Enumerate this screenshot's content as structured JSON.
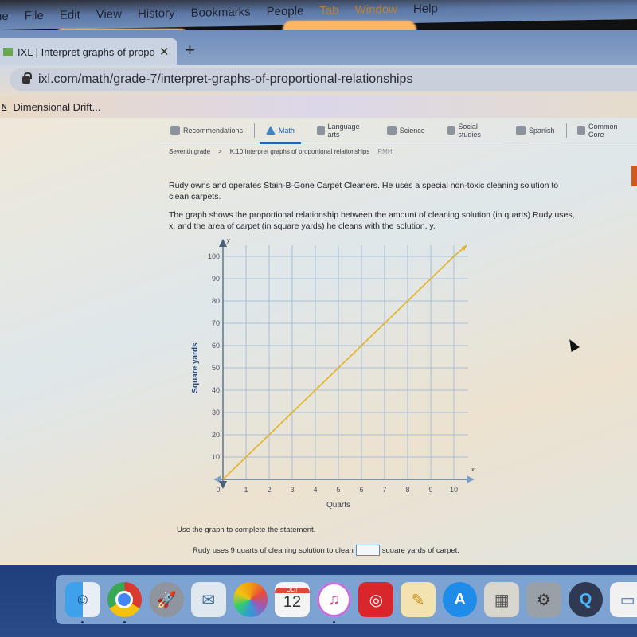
{
  "menubar": {
    "items": [
      "ne",
      "File",
      "Edit",
      "View",
      "History",
      "Bookmarks",
      "People",
      "Tab",
      "Window",
      "Help"
    ]
  },
  "browser": {
    "tab_title": "IXL | Interpret graphs of propo",
    "tab_close": "✕",
    "new_tab": "+",
    "url": "ixl.com/math/grade-7/interpret-graphs-of-proportional-relationships",
    "bookmark": "Dimensional Drift...",
    "bookmark_icon": "N"
  },
  "subject_nav": {
    "items": [
      {
        "label": "Recommendations",
        "icon": "recommendations-icon"
      },
      {
        "label": "Math",
        "icon": "math-icon",
        "active": true
      },
      {
        "label": "Language arts",
        "icon": "language-arts-icon"
      },
      {
        "label": "Science",
        "icon": "science-icon"
      },
      {
        "label": "Social studies",
        "icon": "social-studies-icon"
      },
      {
        "label": "Spanish",
        "icon": "spanish-icon"
      },
      {
        "label": "Common Core",
        "icon": "common-core-icon"
      }
    ]
  },
  "breadcrumb": {
    "grade": "Seventh grade",
    "separator": ">",
    "skill": "K.10 Interpret graphs of proportional relationships",
    "tag": "RMH"
  },
  "question": {
    "paragraph1": "Rudy owns and operates Stain-B-Gone Carpet Cleaners. He uses a special non-toxic cleaning solution to clean carpets.",
    "paragraph2": "The graph shows the proportional relationship between the amount of cleaning solution (in quarts) Rudy uses, x, and the area of carpet (in square yards) he cleans with the solution, y.",
    "instruction": "Use the graph to complete the statement.",
    "statement_before": "Rudy uses 9 quarts of cleaning solution to clean",
    "statement_after": "square yards of carpet.",
    "answer_value": ""
  },
  "chart_data": {
    "type": "line",
    "title": "",
    "xlabel": "Quarts",
    "ylabel": "Square yards",
    "x_axis_letter": "x",
    "y_axis_letter": "y",
    "xlim": [
      0,
      10
    ],
    "ylim": [
      0,
      100
    ],
    "x_ticks": [
      0,
      1,
      2,
      3,
      4,
      5,
      6,
      7,
      8,
      9,
      10
    ],
    "y_ticks": [
      10,
      20,
      30,
      40,
      50,
      60,
      70,
      80,
      90,
      100
    ],
    "grid": true,
    "series": [
      {
        "name": "y = 10x",
        "x": [
          0,
          1,
          2,
          3,
          4,
          5,
          6,
          7,
          8,
          9,
          10
        ],
        "y": [
          0,
          10,
          20,
          30,
          40,
          50,
          60,
          70,
          80,
          90,
          100
        ],
        "color": "#e3b42a"
      }
    ],
    "colors": {
      "grid": "#a9bfd8",
      "axis": "#5f7590",
      "line": "#e3b42a"
    }
  },
  "dock": {
    "apps": [
      {
        "name": "Finder",
        "glyph": "☺",
        "running": true
      },
      {
        "name": "Chrome",
        "glyph": "",
        "running": true
      },
      {
        "name": "Launchpad",
        "glyph": "🚀",
        "running": false
      },
      {
        "name": "Mail",
        "glyph": "✉",
        "running": false
      },
      {
        "name": "Photos",
        "glyph": "",
        "running": false
      },
      {
        "name": "Calendar",
        "month": "OCT",
        "day": "12",
        "running": false
      },
      {
        "name": "iTunes",
        "glyph": "♫",
        "running": true
      },
      {
        "name": "Music app",
        "glyph": "◎",
        "running": false
      },
      {
        "name": "Pages",
        "glyph": "✎",
        "running": false
      },
      {
        "name": "App Store",
        "glyph": "A",
        "running": false
      },
      {
        "name": "Calculator",
        "glyph": "▦",
        "running": false
      },
      {
        "name": "System Preferences",
        "glyph": "⚙",
        "running": false
      },
      {
        "name": "QuickTime",
        "glyph": "Q",
        "running": false
      },
      {
        "name": "Preview",
        "glyph": "▭",
        "running": false
      }
    ]
  }
}
